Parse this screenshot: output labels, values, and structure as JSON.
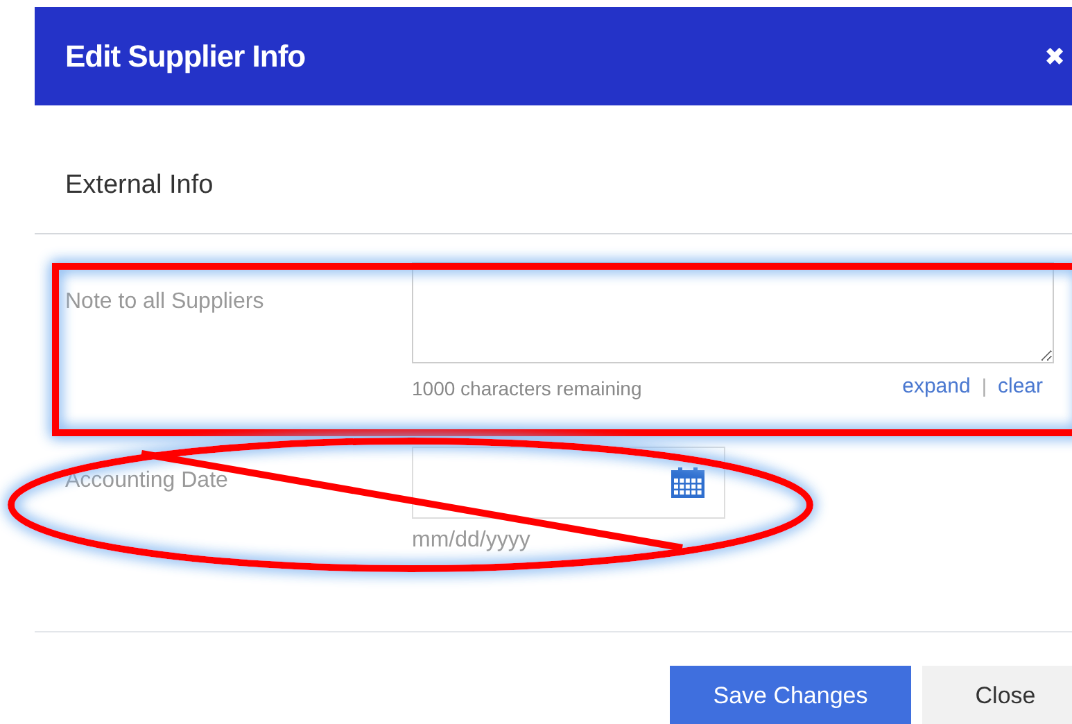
{
  "dialog": {
    "title": "Edit Supplier Info",
    "close_icon": "✖"
  },
  "section": {
    "title": "External Info"
  },
  "note": {
    "label": "Note to all Suppliers",
    "counter": "1000 characters remaining",
    "links": [
      "expand",
      "clear"
    ],
    "separator": "|"
  },
  "date": {
    "label": "Accounting Date",
    "hint": "mm/dd/yyyy"
  },
  "buttons": [
    {
      "label": "Save Changes",
      "kind": "primary"
    },
    {
      "label": "Close",
      "kind": "secondary"
    }
  ],
  "annotations": [
    {
      "kind": "rectangle"
    },
    {
      "kind": "ellipse"
    },
    {
      "kind": "line"
    }
  ]
}
